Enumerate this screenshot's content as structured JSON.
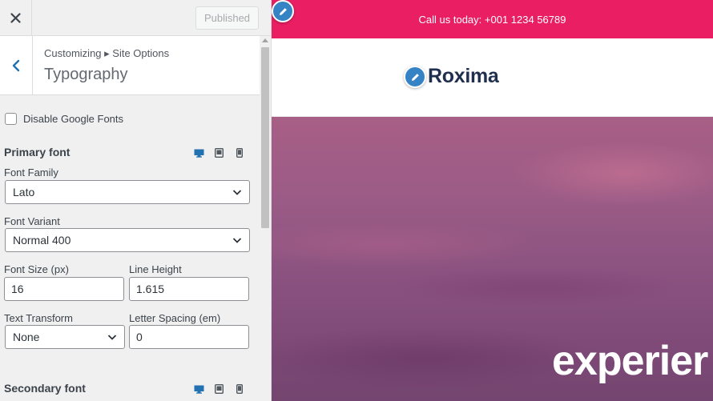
{
  "topbar": {
    "close_icon": "close-icon",
    "publish_label": "Published"
  },
  "section": {
    "breadcrumb": "Customizing ▸ Site Options",
    "title": "Typography",
    "back_icon": "chevron-left-icon"
  },
  "options": {
    "disable_google_fonts_label": "Disable Google Fonts",
    "disable_google_fonts_checked": false
  },
  "primary_font": {
    "title": "Primary font",
    "device_icons": [
      "desktop-icon",
      "tablet-icon",
      "mobile-icon"
    ],
    "font_family_label": "Font Family",
    "font_family_value": "Lato",
    "font_variant_label": "Font Variant",
    "font_variant_value": "Normal 400",
    "font_size_label": "Font Size (px)",
    "font_size_value": "16",
    "line_height_label": "Line Height",
    "line_height_value": "1.615",
    "text_transform_label": "Text Transform",
    "text_transform_value": "None",
    "letter_spacing_label": "Letter Spacing (em)",
    "letter_spacing_value": "0"
  },
  "secondary_font": {
    "title": "Secondary font"
  },
  "preview": {
    "topbar_text": "Call us today: +001 1234 56789",
    "topbar_color": "#ea1e63",
    "accent_color": "#3582c4",
    "logo_text": "Roxima",
    "hero_text": "experier"
  }
}
